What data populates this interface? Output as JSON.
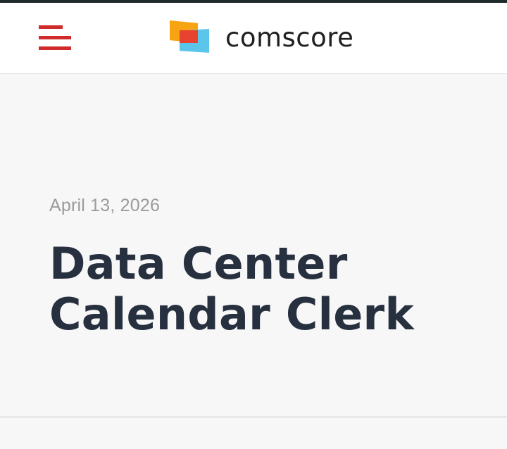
{
  "colors": {
    "accent": "#d12c2c",
    "orange": "#f7a413",
    "blue": "#5bc6ea",
    "red": "#e8432e"
  },
  "header": {
    "menu_icon": "hamburger-menu-icon",
    "logo_text": "comscore"
  },
  "article": {
    "date": "April 13, 2026",
    "title": "Data Center Calendar Clerk"
  }
}
